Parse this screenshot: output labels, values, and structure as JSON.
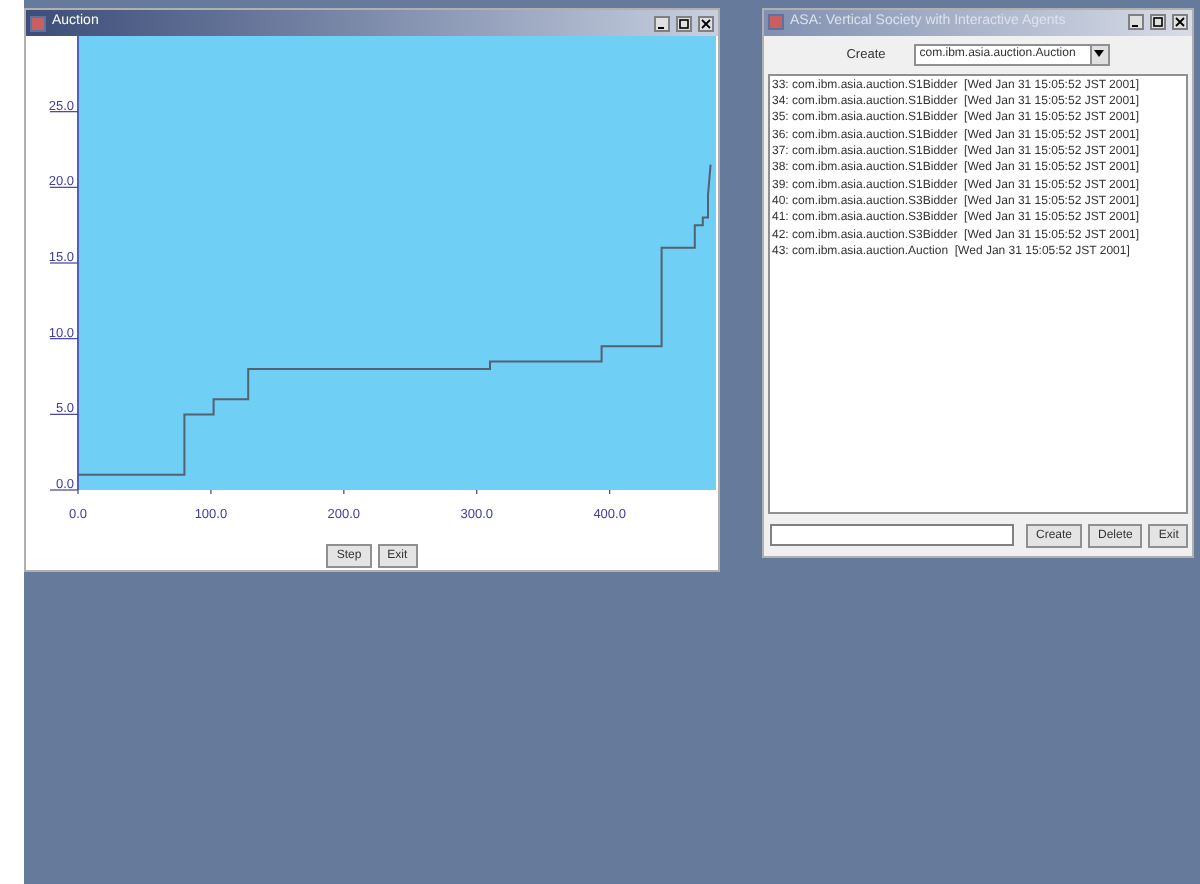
{
  "auction_window": {
    "title": "Auction",
    "chart_data": {
      "type": "line",
      "xlim": [
        0,
        480
      ],
      "ylim": [
        0,
        30
      ],
      "xticks": [
        {
          "value": 0,
          "label": "0.0"
        },
        {
          "value": 100,
          "label": "100.0"
        },
        {
          "value": 200,
          "label": "200.0"
        },
        {
          "value": 300,
          "label": "300.0"
        },
        {
          "value": 400,
          "label": "400.0"
        }
      ],
      "yticks": [
        {
          "value": 0,
          "label": "0.0"
        },
        {
          "value": 5,
          "label": "5.0"
        },
        {
          "value": 10,
          "label": "10.0"
        },
        {
          "value": 15,
          "label": "15.0"
        },
        {
          "value": 20,
          "label": "20.0"
        },
        {
          "value": 25,
          "label": "25.0"
        }
      ],
      "x": [
        0,
        80,
        80,
        102,
        102,
        128,
        128,
        310,
        310,
        394,
        394,
        439,
        439,
        464,
        464,
        470,
        470,
        474,
        474,
        476
      ],
      "series": [
        {
          "color": "#556070",
          "values": [
            1,
            1,
            5,
            5,
            6,
            6,
            8,
            8,
            8.5,
            8.5,
            9.5,
            9.5,
            16,
            16,
            17.5,
            17.5,
            18,
            18,
            19.5,
            21.5
          ]
        }
      ]
    },
    "buttons": [
      "Step",
      "Exit"
    ]
  },
  "agents_window": {
    "title": "ASA: Vertical Society with Interactive Agents",
    "create_label": "Create",
    "create_select": "com.ibm.asia.auction.Auction",
    "entries": [
      "33: com.ibm.asia.auction.S1Bidder  [Wed Jan 31 15:05:52 JST 2001]",
      "34: com.ibm.asia.auction.S1Bidder  [Wed Jan 31 15:05:52 JST 2001]",
      "35: com.ibm.asia.auction.S1Bidder  [Wed Jan 31 15:05:52 JST 2001]",
      "36: com.ibm.asia.auction.S1Bidder  [Wed Jan 31 15:05:52 JST 2001]",
      "37: com.ibm.asia.auction.S1Bidder  [Wed Jan 31 15:05:52 JST 2001]",
      "38: com.ibm.asia.auction.S1Bidder  [Wed Jan 31 15:05:52 JST 2001]",
      "39: com.ibm.asia.auction.S1Bidder  [Wed Jan 31 15:05:52 JST 2001]",
      "40: com.ibm.asia.auction.S3Bidder  [Wed Jan 31 15:05:52 JST 2001]",
      "41: com.ibm.asia.auction.S3Bidder  [Wed Jan 31 15:05:52 JST 2001]",
      "42: com.ibm.asia.auction.S3Bidder  [Wed Jan 31 15:05:52 JST 2001]",
      "43: com.ibm.asia.auction.Auction  [Wed Jan 31 15:05:52 JST 2001]"
    ],
    "buttons": [
      "Create",
      "Delete",
      "Exit"
    ]
  }
}
